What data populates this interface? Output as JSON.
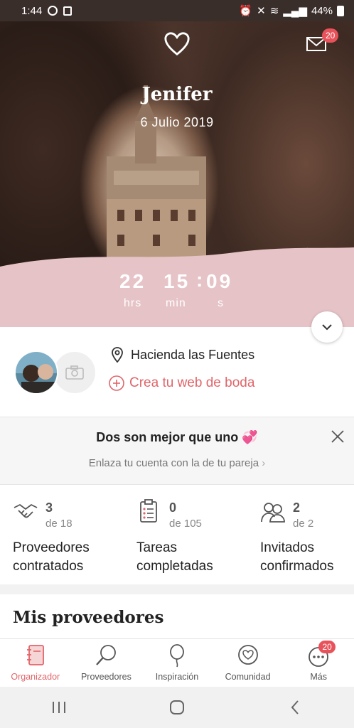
{
  "status_bar": {
    "time": "1:44",
    "battery": "44%"
  },
  "header": {
    "mail_badge": "20"
  },
  "hero": {
    "name": "Jenifer",
    "date": "6 Julio 2019"
  },
  "countdown": {
    "hours": "22",
    "minutes": "15",
    "seconds": "09",
    "hours_label": "hrs",
    "minutes_label": "min",
    "seconds_label": "s"
  },
  "couple": {
    "venue": "Hacienda las Fuentes",
    "web_link": "Crea tu web de boda"
  },
  "promo": {
    "title": "Dos son mejor que uno",
    "link": "Enlaza tu cuenta con la de tu pareja"
  },
  "stats": [
    {
      "count": "3",
      "total": "de 18",
      "label_1": "Proveedores",
      "label_2": "contratados",
      "icon": "handshake-icon"
    },
    {
      "count": "0",
      "total": "de 105",
      "label_1": "Tareas",
      "label_2": "completadas",
      "icon": "checklist-icon"
    },
    {
      "count": "2",
      "total": "de 2",
      "label_1": "Invitados",
      "label_2": "confirmados",
      "icon": "guests-icon"
    }
  ],
  "section": {
    "title": "Mis proveedores"
  },
  "bottom_nav": {
    "items": [
      {
        "label": "Organizador",
        "icon": "notebook-icon"
      },
      {
        "label": "Proveedores",
        "icon": "magnifier-icon"
      },
      {
        "label": "Inspiración",
        "icon": "balloon-icon"
      },
      {
        "label": "Comunidad",
        "icon": "heart-chat-icon"
      },
      {
        "label": "Más",
        "icon": "more-icon"
      }
    ],
    "more_badge": "20"
  },
  "colors": {
    "accent": "#e0656a",
    "badge": "#e8525a",
    "band": "#e6c3c6"
  }
}
